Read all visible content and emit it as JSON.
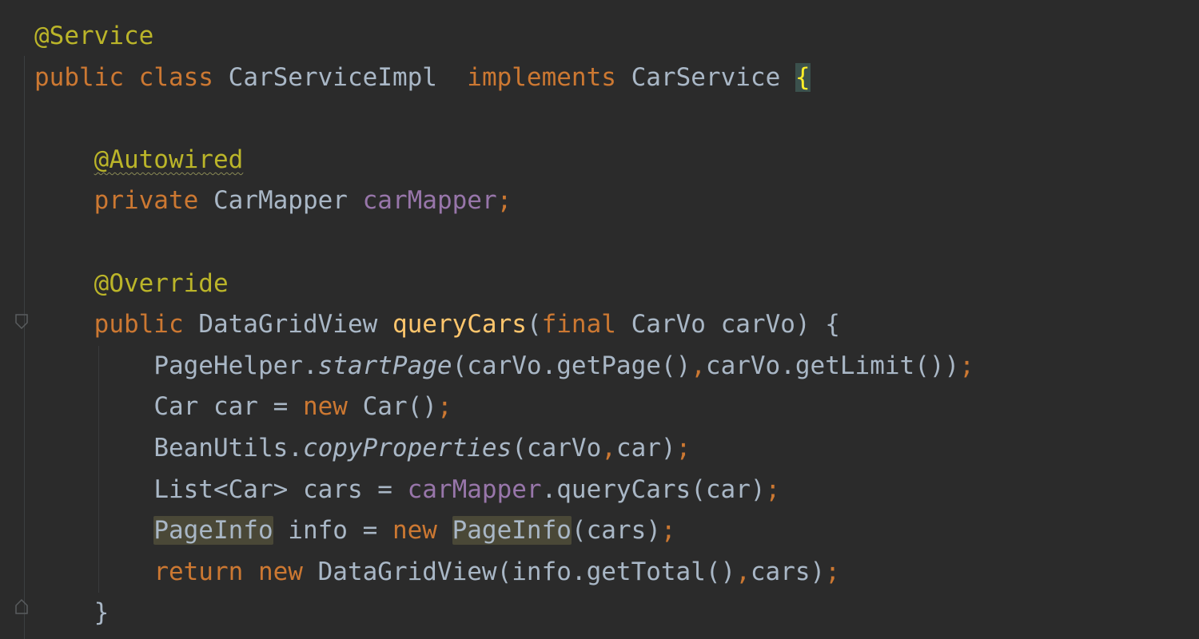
{
  "editor": {
    "colors": {
      "background": "#2b2b2b",
      "default_text": "#a9b7c6",
      "keyword": "#cc7832",
      "annotation": "#bbb529",
      "field": "#9876aa",
      "method_decl": "#ffc66d",
      "brace_match_bg": "#3b514d",
      "usage_highlight_bg": "#4a4837"
    },
    "lines": [
      {
        "annotation": "@Service"
      },
      {
        "kw_public": "public",
        "kw_class": "class",
        "class_name": "CarServiceImpl",
        "kw_implements": "implements",
        "interface_name": "CarService",
        "open_brace": "{"
      },
      {},
      {
        "annotation": "@Autowired"
      },
      {
        "kw_private": "private",
        "type": "CarMapper",
        "field": "carMapper",
        "semi": ";"
      },
      {},
      {
        "annotation": "@Override"
      },
      {
        "kw_public": "public",
        "return_type": "DataGridView",
        "method": "queryCars",
        "lparen": "(",
        "kw_final": "final",
        "param_type": "CarVo",
        "param_name": "carVo",
        "rparen_brace": ") {"
      },
      {
        "p1": "PageHelper.",
        "p2": "startPage",
        "p3": "(carVo.getPage()",
        "p4": ",",
        "p5": "carVo.getLimit())",
        "p6": ";"
      },
      {
        "p1": "Car car = ",
        "kw_new": "new",
        "p2": " Car()",
        "p3": ";"
      },
      {
        "p1": "BeanUtils.",
        "p2": "copyProperties",
        "p3": "(carVo",
        "p4": ",",
        "p5": "car)",
        "p6": ";"
      },
      {
        "p1": "List<Car> cars = ",
        "field": "carMapper",
        "p2": ".queryCars(car)",
        "p3": ";"
      },
      {
        "t1": "PageInfo",
        "p1": " info = ",
        "kw_new": "new",
        "t2": "PageInfo",
        "p2": "(cars)",
        "p3": ";"
      },
      {
        "kw_return": "return",
        "kw_new": "new",
        "p1": " DataGridView(info.getTotal()",
        "p2": ",",
        "p3": "cars)",
        "p4": ";"
      },
      {
        "close_brace": "}"
      }
    ]
  }
}
